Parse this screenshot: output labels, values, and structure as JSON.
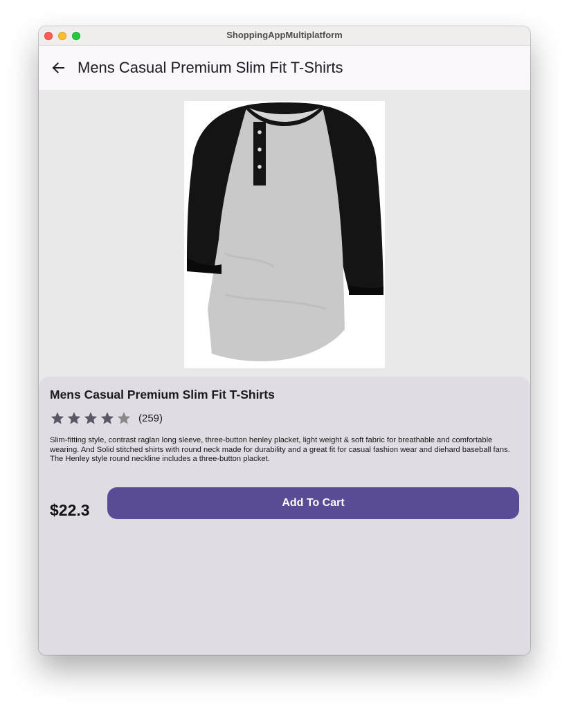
{
  "window": {
    "title": "ShoppingAppMultiplatform"
  },
  "appbar": {
    "back_icon": "arrow-left-icon",
    "title": "Mens Casual Premium Slim Fit T-Shirts"
  },
  "product": {
    "image_icon": "henley-tshirt-image",
    "title": "Mens Casual Premium Slim Fit T-Shirts",
    "rating_value": 4.1,
    "rating_max": 5,
    "review_count": "(259)",
    "description": "Slim-fitting style, contrast raglan long sleeve, three-button henley placket, light weight & soft fabric for breathable and comfortable wearing. And Solid stitched shirts with round neck made for durability and a great fit for casual fashion wear and diehard baseball fans. The Henley style round neckline includes a three-button placket.",
    "price": "$22.3",
    "add_to_cart_label": "Add To Cart"
  },
  "colors": {
    "appbar_bg": "#fcf6fd",
    "sheet_bg": "#e1dce3",
    "primary": "#5b4a95",
    "star_filled": "#5b5566",
    "star_empty": "#888888"
  }
}
